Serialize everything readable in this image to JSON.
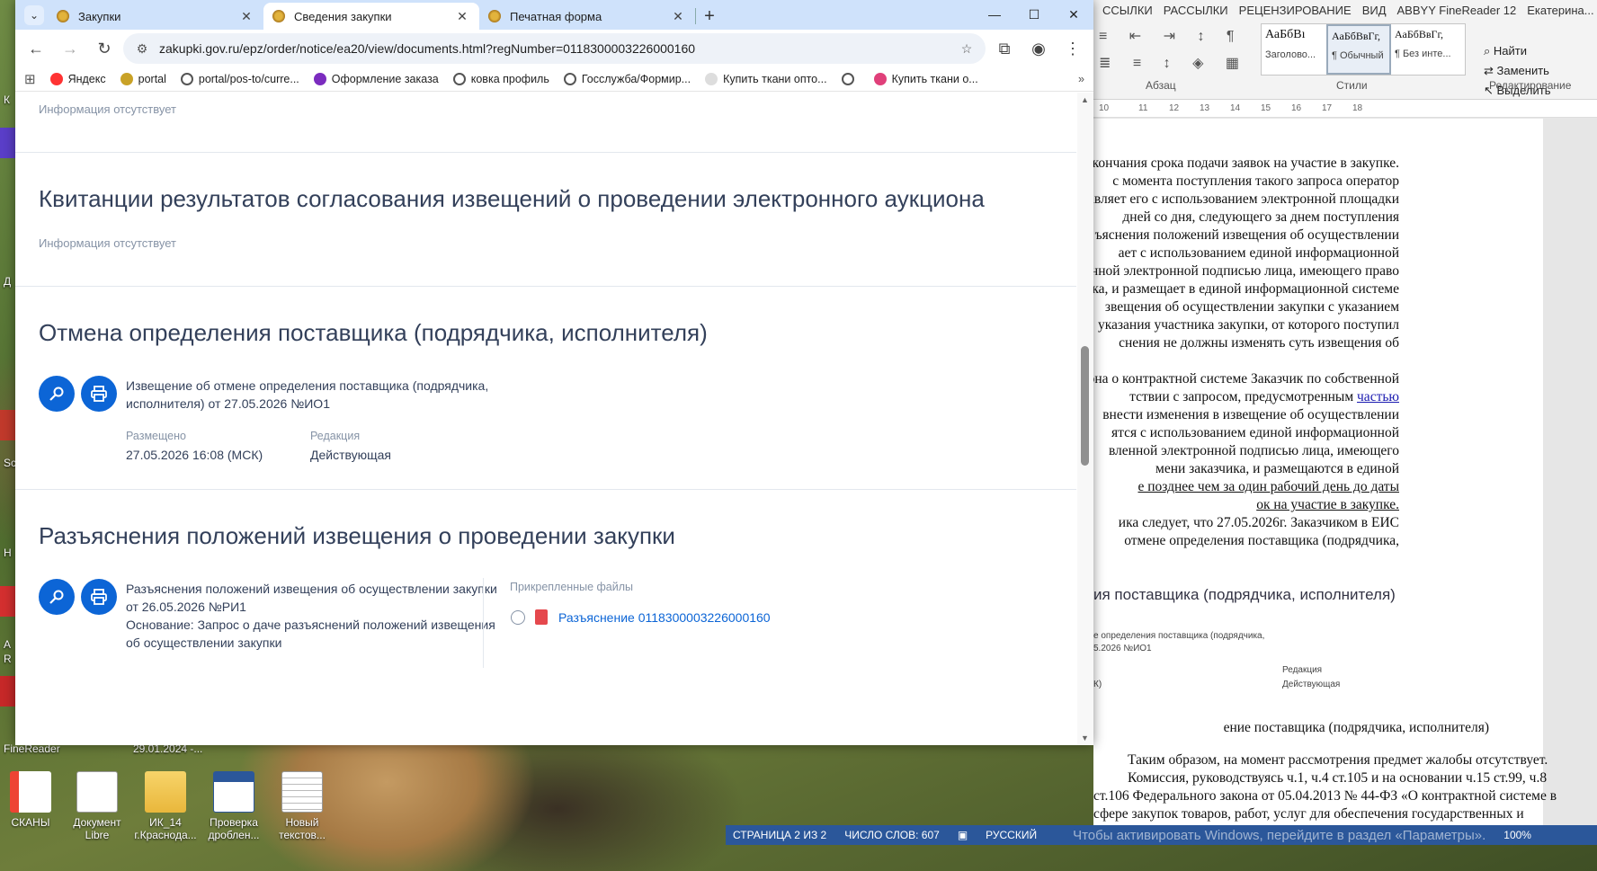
{
  "chrome": {
    "tabs": [
      {
        "title": "Закупки",
        "active": false
      },
      {
        "title": "Сведения закупки",
        "active": true
      },
      {
        "title": "Печатная форма",
        "active": false
      }
    ],
    "url": "zakupki.gov.ru/epz/order/notice/ea20/view/documents.html?regNumber=0118300003226000160",
    "bookmarks": [
      "Яндекс",
      "portal",
      "portal/pos-to/curre...",
      "Оформление заказа",
      "ковка профиль",
      "Госслужба/Формир...",
      "Купить ткани опто...",
      "",
      "Купить ткани о..."
    ],
    "colors": {
      "accent": "#0c65d6",
      "tabstrip": "#cfe2fb",
      "text": "#33405a",
      "muted": "#8693a6"
    }
  },
  "page": {
    "top_info": "Информация отсутствует",
    "receipts": {
      "title": "Квитанции результатов согласования извещений о проведении электронного аукциона",
      "info": "Информация отсутствует"
    },
    "cancel": {
      "title": "Отмена определения поставщика (подрядчика, исполнителя)",
      "doc_line1": "Извещение об отмене определения поставщика (подрядчика,",
      "doc_line2": "исполнителя) от 27.05.2026 №ИО1",
      "placed_label": "Размещено",
      "placed_value": "27.05.2026 16:08 (МСК)",
      "edition_label": "Редакция",
      "edition_value": "Действующая"
    },
    "clarifications": {
      "title": "Разъяснения положений извещения о проведении закупки",
      "doc_line1": "Разъяснения положений извещения об осуществлении закупки",
      "doc_line2": "от 26.05.2026 №РИ1",
      "doc_line3": "Основание: Запрос о даче разъяснений положений извещения",
      "doc_line4": "об осуществлении закупки",
      "attached_label": "Прикрепленные файлы",
      "attached_file": "Разъяснение 0118300003226000160"
    }
  },
  "word": {
    "ribbon_tabs": [
      "ССЫЛКИ",
      "РАССЫЛКИ",
      "РЕЦЕНЗИРОВАНИЕ",
      "ВИД",
      "ABBYY FineReader 12",
      "Екатерина..."
    ],
    "styles": [
      {
        "preview": "АаБбВı",
        "name": "Заголово..."
      },
      {
        "preview": "АаБбВвГг,",
        "name": "¶ Обычный"
      },
      {
        "preview": "АаБбВвГг,",
        "name": "¶ Без инте..."
      }
    ],
    "edit_cmds": [
      "Найти",
      "Заменить",
      "Выделить"
    ],
    "group_labels": [
      "Абзац",
      "Стили",
      "Редактирование"
    ],
    "ruler": [
      "10",
      "11",
      "12",
      "13",
      "14",
      "15",
      "16",
      "17",
      "18"
    ],
    "doc_lines": [
      "окончания срока подачи заявок на участие в закупке.",
      "с момента поступления такого запроса оператор",
      "равляет его с использованием электронной площадки",
      "дней со дня, следующего за днем поступления",
      "ъяснения положений извещения об осуществлении",
      "ает с использованием единой информационной",
      "иленной электронной подписью лица, имеющего право",
      "чика, и размещает в единой информационной системе",
      "звещения об осуществлении закупки с указанием",
      "указания участника закупки, от которого поступил",
      "снения не должны изменять суть извещения об",
      "",
      "кона о контрактной системе Заказчик по собственной",
      "тствии с запросом, предусмотренным",
      "внести изменения в извещение об осуществлении",
      "ятся с использованием единой информационной",
      "вленной электронной подписью лица, имеющего",
      "мени заказчика, и размещаются в единой",
      "е позднее чем за один рабочий день до даты",
      "ок на участие в закупке.",
      "ика следует, что 27.05.2026г. Заказчиком в ЕИС",
      "отмене определения поставщика (подрядчика,"
    ],
    "link_word": "частью",
    "embed_title": "ия поставщика (подрядчика, исполнителя)",
    "embed_small1": "е определения поставщика (подрядчика,",
    "embed_small2": "5.2026 №ИО1",
    "embed_small3": "Редакция",
    "embed_small4": "Действующая",
    "embed_small5": "К)",
    "bottom_lines": [
      "ение поставщика (подрядчика, исполнителя)",
      "Таким образом, на момент рассмотрения предмет жалобы отсутствует.",
      "Комиссия, руководствуясь ч.1, ч.4 ст.105 и на основании ч.15 ст.99, ч.8",
      "ст.106 Федерального закона от 05.04.2013 № 44-ФЗ «О контрактной системе в",
      "сфере закупок товаров, работ, услуг для обеспечения государственных и"
    ],
    "status": {
      "page": "СТРАНИЦА 2 ИЗ 2",
      "words": "ЧИСЛО СЛОВ: 607",
      "lang": "РУССКИЙ",
      "watermark": "Чтобы активировать Windows, перейдите в раздел «Параметры».",
      "zoom": "100%"
    }
  },
  "desktop": {
    "icons": [
      {
        "label": "СКАНЫ"
      },
      {
        "label": "Документ Libre"
      },
      {
        "label": "ИК_14 г.Краснода..."
      },
      {
        "label": "Проверка дроблен..."
      },
      {
        "label": "Новый текстов..."
      }
    ],
    "left_labels": [
      "К",
      "Д",
      "Sc",
      "Н",
      "А",
      "R"
    ],
    "finereader_label": "FineReader",
    "date_label": "29.01.2024 -..."
  }
}
